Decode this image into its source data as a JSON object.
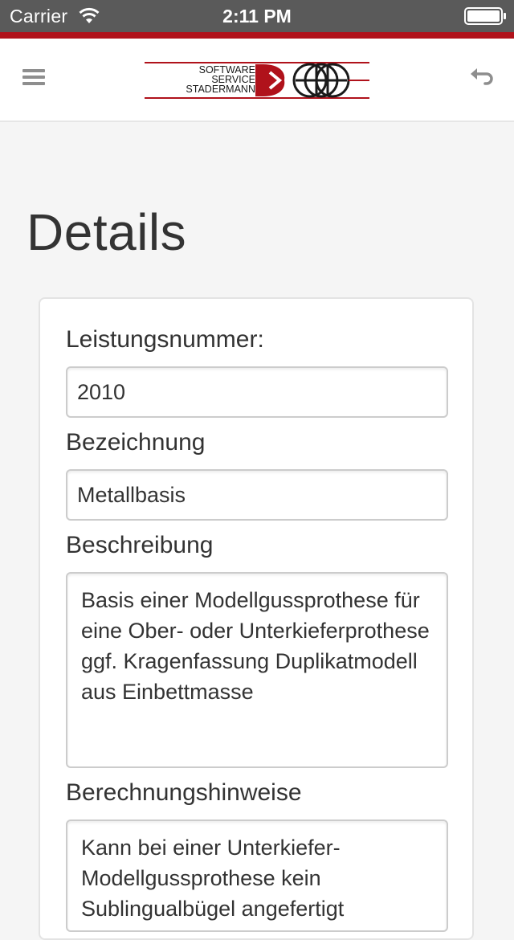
{
  "status_bar": {
    "carrier": "Carrier",
    "time": "2:11 PM",
    "icons": [
      "wifi-icon",
      "battery-icon"
    ]
  },
  "nav": {
    "logo_text": [
      "SOFTWARE",
      "SERVICE",
      "STADERMANN"
    ],
    "icons": [
      "menu-icon",
      "back-icon"
    ],
    "accent_color": "#b0121b"
  },
  "page": {
    "title": "Details"
  },
  "form": {
    "leistungsnummer_label": "Leistungsnummer:",
    "leistungsnummer_value": "2010",
    "bezeichnung_label": "Bezeichnung",
    "bezeichnung_value": "Metallbasis",
    "beschreibung_label": "Beschreibung",
    "beschreibung_value": "Basis einer Modellgussprothese für eine Ober- oder Unterkieferprothese  ggf. Kragenfassung Duplikatmodell aus Einbettmasse",
    "berechnungshinweise_label": "Berechnungshinweise",
    "berechnungshinweise_value": "Kann bei einer Unterkiefer-Modellgussprothese kein Sublingualbügel angefertigt"
  }
}
